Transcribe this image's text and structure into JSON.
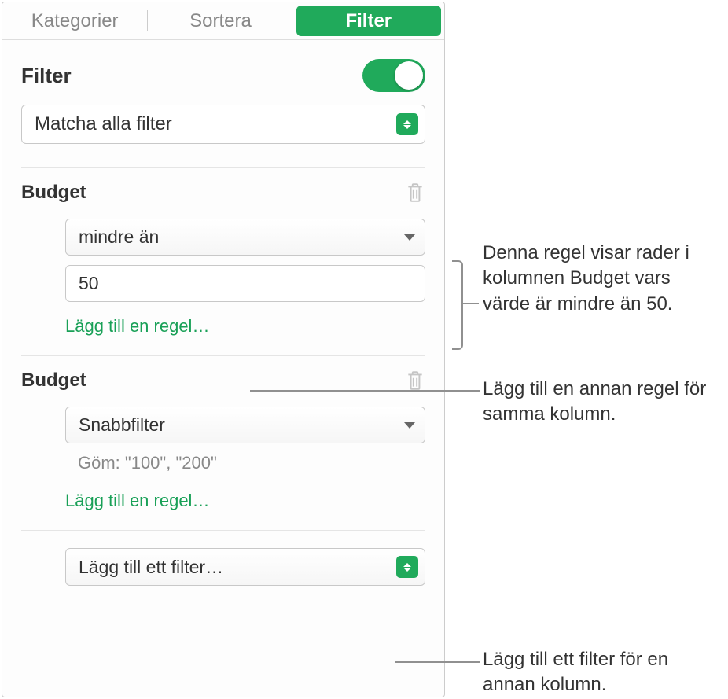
{
  "tabs": {
    "categories": "Kategorier",
    "sort": "Sortera",
    "filter": "Filter"
  },
  "filter": {
    "title": "Filter",
    "toggle_on": true,
    "match_label": "Matcha alla filter"
  },
  "rules": [
    {
      "column": "Budget",
      "operator": "mindre än",
      "value": "50",
      "add_rule_label": "Lägg till en regel…"
    },
    {
      "column": "Budget",
      "operator": "Snabbfilter",
      "hide_text": "Göm: \"100\", \"200\"",
      "add_rule_label": "Lägg till en regel…"
    }
  ],
  "add_filter_label": "Lägg till ett filter…",
  "callouts": {
    "c1": "Denna regel visar rader i kolumnen Budget vars värde är mindre än 50.",
    "c2": "Lägg till en annan regel för samma kolumn.",
    "c3": "Lägg till ett filter för en annan kolumn."
  }
}
